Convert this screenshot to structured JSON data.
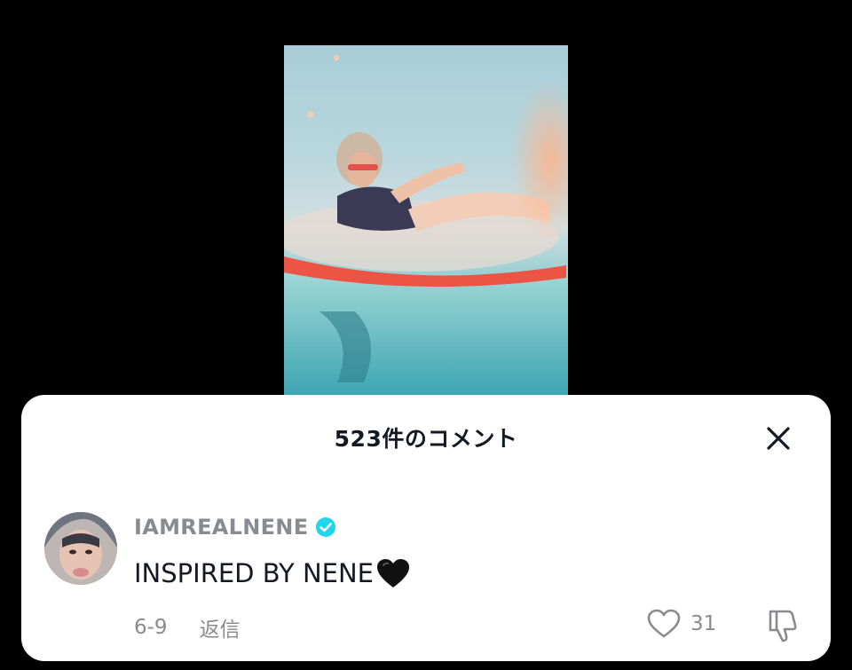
{
  "video": {
    "icons": [
      "video-thumbnail"
    ]
  },
  "comments_sheet": {
    "title": "523件のコメント",
    "close_icon": "close-icon"
  },
  "comment": {
    "username": "IAMREALNENE",
    "verified": true,
    "text": "INSPIRED BY NENE",
    "emoji": "🖤",
    "date": "6-9",
    "reply_label": "返信",
    "like_count": "31",
    "icons": [
      "verified-badge-icon",
      "heart-icon",
      "dislike-icon"
    ]
  },
  "colors": {
    "background": "#000000",
    "sheet": "#ffffff",
    "muted_text": "#8a8b91",
    "primary_text": "#161823",
    "verified": "#20d5ec"
  }
}
